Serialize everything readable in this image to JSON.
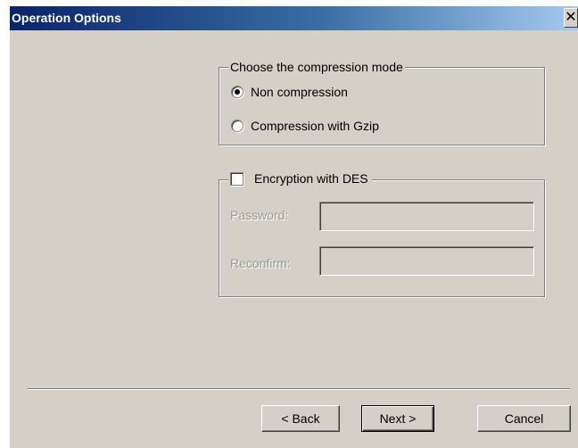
{
  "window": {
    "title": "Operation Options",
    "close_glyph": "✕"
  },
  "compression": {
    "legend": "Choose the compression mode",
    "options": [
      {
        "label": "Non compression",
        "checked": true
      },
      {
        "label": "Compression with Gzip",
        "checked": false
      }
    ]
  },
  "encryption": {
    "checkbox_label": "Encryption with DES",
    "checked": false,
    "password_label": "Password:",
    "password_value": "",
    "reconfirm_label": "Reconfirm:",
    "reconfirm_value": ""
  },
  "buttons": {
    "back": "< Back",
    "next": "Next >",
    "cancel": "Cancel"
  }
}
